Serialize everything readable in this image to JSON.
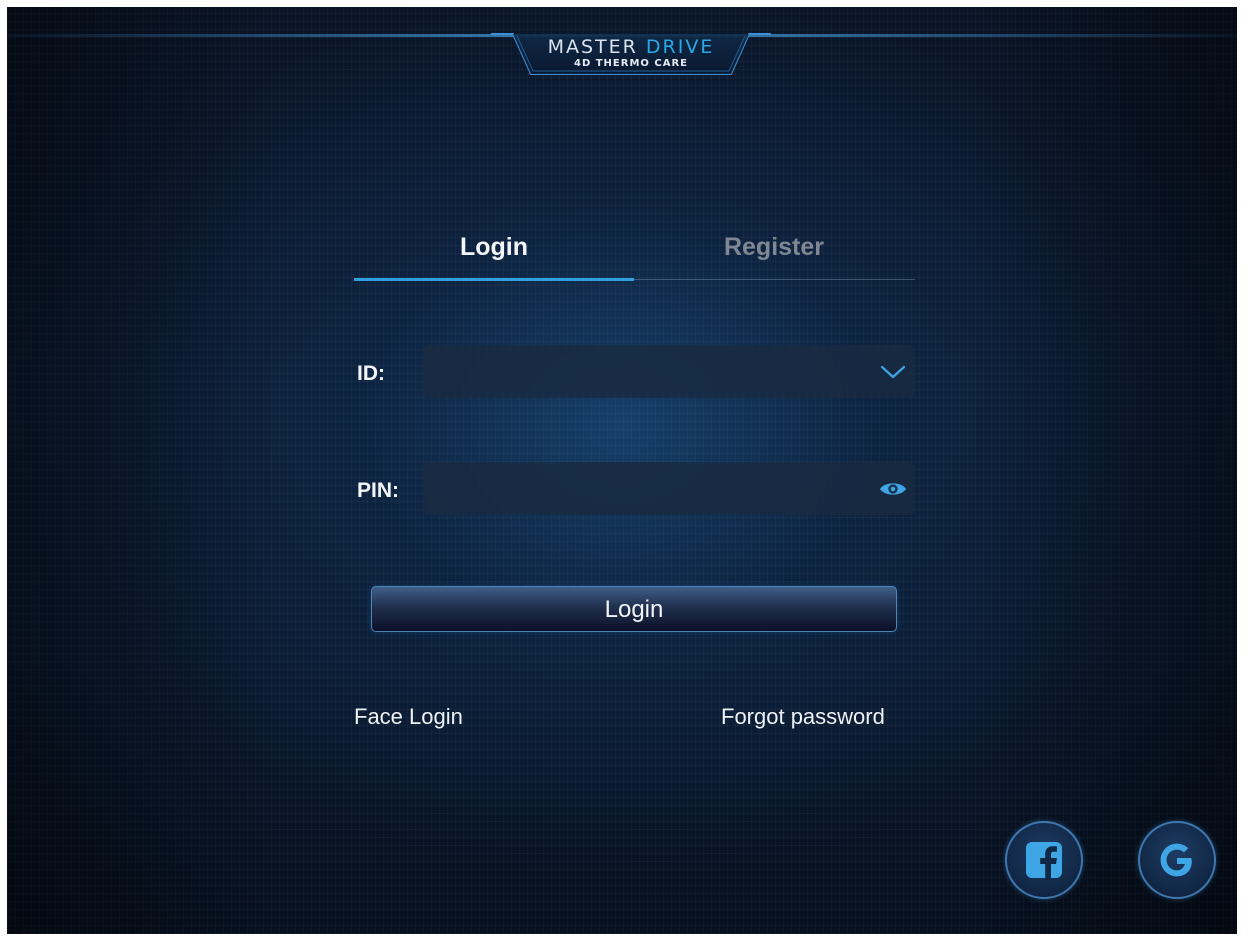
{
  "header": {
    "logo_word1": "MASTER",
    "logo_word2": "DRIVE",
    "logo_sub": "4D THERMO CARE"
  },
  "tabs": [
    {
      "label": "Login",
      "active": true
    },
    {
      "label": "Register",
      "active": false
    }
  ],
  "form": {
    "id_label": "ID:",
    "id_value": "",
    "id_icon": "chevron-down-icon",
    "pin_label": "PIN:",
    "pin_value": "",
    "pin_icon": "eye-icon",
    "submit_label": "Login"
  },
  "links": {
    "face_login": "Face Login",
    "forgot_password": "Forgot password"
  },
  "social": [
    {
      "name": "facebook",
      "icon": "facebook-icon"
    },
    {
      "name": "google",
      "icon": "google-icon"
    }
  ],
  "colors": {
    "accent": "#2f9fe0",
    "background": "#0b1a30",
    "inactive_tab": "#7f8793"
  }
}
